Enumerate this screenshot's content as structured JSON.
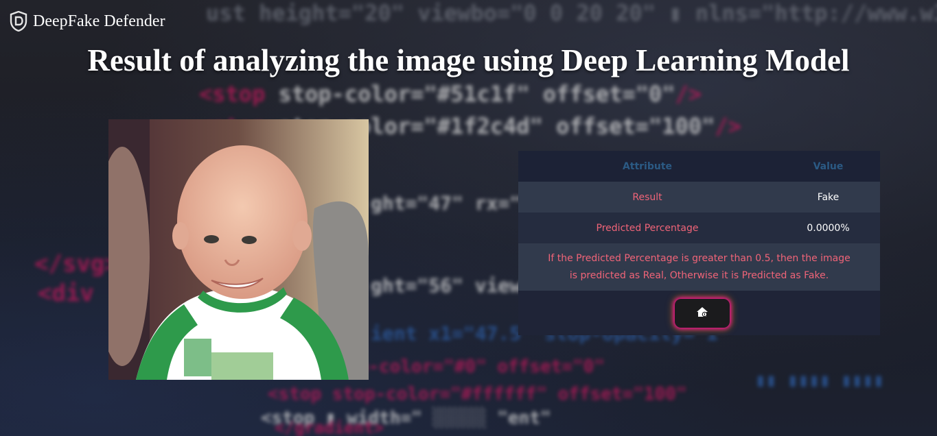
{
  "brand": {
    "name": "DeepFake Defender",
    "logo_icon": "shield-logo-icon"
  },
  "page": {
    "title": "Result of analyzing the image using Deep Learning Model"
  },
  "image": {
    "alt": "Analyzed image of a smiling baby in a green and white shirt"
  },
  "result_table": {
    "headers": {
      "attribute": "Attribute",
      "value": "Value"
    },
    "rows": [
      {
        "attribute": "Result",
        "value": "Fake"
      },
      {
        "attribute": "Predicted Percentage",
        "value": "0.0000%"
      }
    ],
    "note": "If the Predicted Percentage is greater than 0.5, then the image is predicted as Real, Otherwise it is Predicted as Fake."
  },
  "home_button": {
    "icon": "home-icon"
  },
  "colors": {
    "header_text": "#2b5a84",
    "attribute_text": "#f06478",
    "value_text": "#ffffff",
    "panel_bg": "#1f2437",
    "button_glow": "#ff00aa"
  }
}
